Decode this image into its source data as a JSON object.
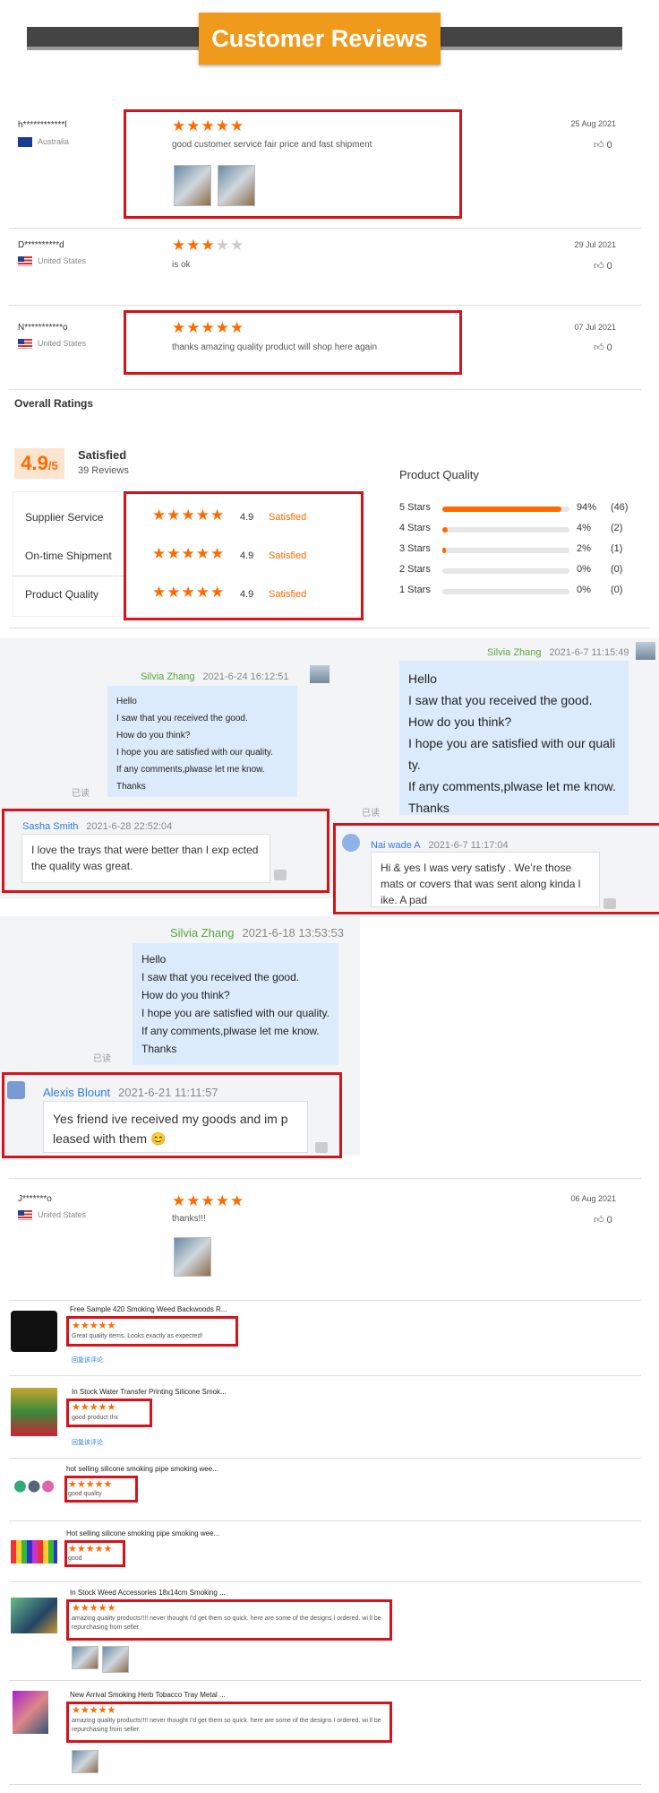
{
  "header": {
    "title": "Customer Reviews"
  },
  "reviews": [
    {
      "user": "h************l",
      "country": "Australia",
      "stars": 5,
      "text": "good customer service fair price and fast shipment",
      "date": "25 Aug 2021",
      "likes": "0"
    },
    {
      "user": "D**********d",
      "country": "United States",
      "stars": 3,
      "text": "is ok",
      "date": "29 Jul 2021",
      "likes": "0"
    },
    {
      "user": "N***********o",
      "country": "United States",
      "stars": 5,
      "text": "thanks amazing quality product will shop here again",
      "date": "07 Jul 2021",
      "likes": "0"
    }
  ],
  "overall": {
    "title": "Overall Ratings",
    "score": "4.9",
    "score_den": "/5",
    "verdict": "Satisfied",
    "count": "39 Reviews",
    "rows": [
      {
        "label": "Supplier Service",
        "num": "4.9",
        "sat": "Satisfied"
      },
      {
        "label": "On-time Shipment",
        "num": "4.9",
        "sat": "Satisfied"
      },
      {
        "label": "Product Quality",
        "num": "4.9",
        "sat": "Satisfied"
      }
    ],
    "pq_title": "Product Quality",
    "pq": [
      {
        "label": "5 Stars",
        "fraction": 0.94,
        "pct": "94%",
        "count": "(46)"
      },
      {
        "label": "4 Stars",
        "fraction": 0.04,
        "pct": "4%",
        "count": "(2)"
      },
      {
        "label": "3 Stars",
        "fraction": 0.02,
        "pct": "2%",
        "count": "(1)"
      },
      {
        "label": "2 Stars",
        "fraction": 0.0,
        "pct": "0%",
        "count": "(0)"
      },
      {
        "label": "1 Stars",
        "fraction": 0.0,
        "pct": "0%",
        "count": "(0)"
      }
    ]
  },
  "chats": [
    {
      "seller": "Silvia Zhang",
      "time": "2021-6-24 16:12:51",
      "lines": [
        "Hello",
        "I saw that you received the good.",
        "How do you think?",
        "I hope you are satisfied with our quality.",
        "If any comments,plwase let me know.",
        "Thanks"
      ],
      "read": "已读",
      "buyer": "Sasha Smith",
      "buyer_time": "2021-6-28 22:52:04",
      "reply": "I love the trays that were better than I exp ected the quality was great."
    },
    {
      "seller": "Silvia Zhang",
      "time": "2021-6-7 11:15:49",
      "lines": [
        "Hello",
        "I saw that you received the good.",
        "How do you think?",
        "I hope you are satisfied with our quali ty.",
        "If any comments,plwase let me know.",
        "Thanks"
      ],
      "read": "已读",
      "buyer": "Nai wade A",
      "buyer_time": "2021-6-7 11:17:04",
      "reply": "Hi & yes I was very satisfy . We’re those mats or covers that was sent along kinda l ike. A pad"
    },
    {
      "seller": "Silvia Zhang",
      "time": "2021-6-18 13:53:53",
      "lines": [
        "Hello",
        "I saw that you received the good.",
        "How do you think?",
        "I hope you are satisfied with our quality.",
        "If any comments,plwase let me know.",
        "Thanks"
      ],
      "read": "已读",
      "buyer": "Alexis Blount",
      "buyer_time": "2021-6-21 11:11:57",
      "reply": "Yes friend ive received my goods and im p leased with them"
    }
  ],
  "review4": {
    "user": "J*******o",
    "country": "United States",
    "stars": 5,
    "text": "thanks!!!",
    "date": "06 Aug 2021",
    "likes": "0"
  },
  "products": [
    {
      "title": "Free Sample 420 Smoking Weed Backwoods R...",
      "text": "Great quality items. Looks exactly as expected!",
      "link": "回复该评论"
    },
    {
      "title": "In Stock Water Transfer Printing Silicone Smok...",
      "text": "good product thx",
      "link": "回复该评论"
    },
    {
      "title": "hot selling silicone smoking pipe smoking wee...",
      "text": "good quality"
    },
    {
      "title": "Hot selling silicone smoking pipe smoking wee...",
      "text": "good"
    },
    {
      "title": "In Stock Weed Accessories 18x14cm Smoking ...",
      "text": "amazing quality products!!!! never thought I'd get them so quick. here are some of the designs I ordered. wi ll be repurchasing from seller"
    },
    {
      "title": "New Arrival Smoking Herb Tobacco Tray Metal ...",
      "text": "amazing quality products!!!! never thought I'd get them so quick. here are some of the designs I ordered. wi ll be repurchasing from seller"
    }
  ],
  "colors": {
    "accent": "#ff6a00",
    "header_btn": "#f09a1c",
    "redbox": "#d4141c",
    "bubble": "#dcebfb"
  }
}
